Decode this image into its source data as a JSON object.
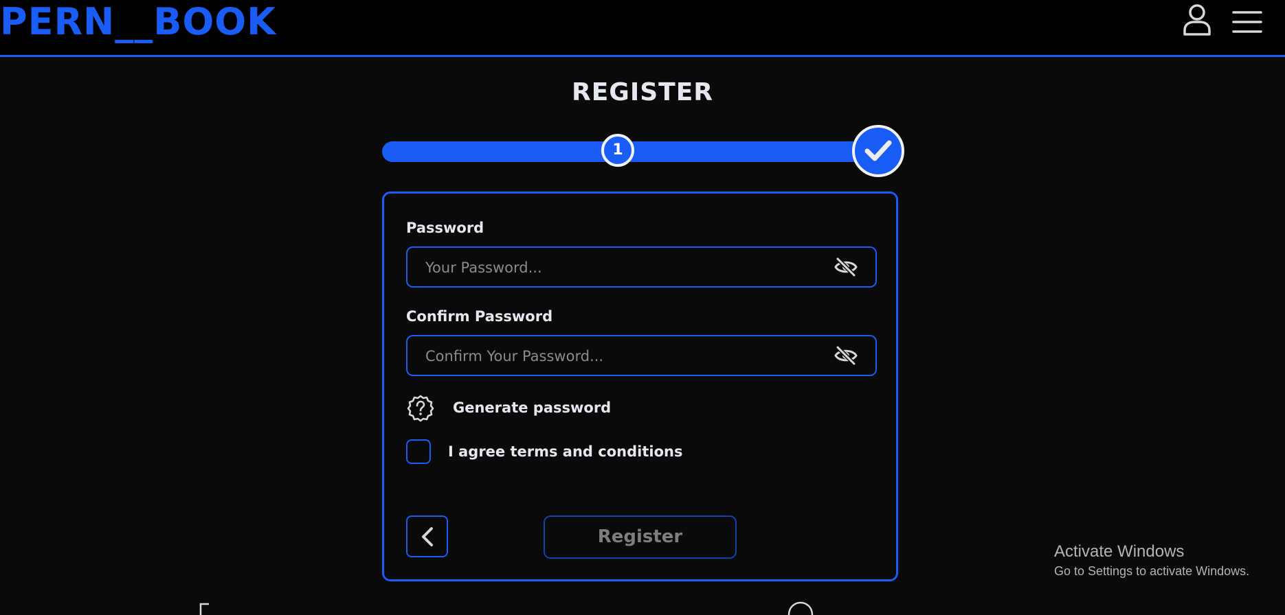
{
  "header": {
    "logo": "PERN__BOOK",
    "user_icon": "user-icon",
    "menu_icon": "hamburger-menu-icon"
  },
  "page": {
    "title": "REGISTER"
  },
  "stepper": {
    "step_label": "1",
    "done_icon": "check-icon"
  },
  "form": {
    "password_label": "Password",
    "password_placeholder": "Your Password...",
    "confirm_label": "Confirm Password",
    "confirm_placeholder": "Confirm Your Password...",
    "visibility_icon": "eye-off-icon",
    "generate_label": "Generate password",
    "generate_icon": "question-badge-icon",
    "agree_label": "I agree terms and conditions",
    "agree_checked": false,
    "back_icon": "chevron-left-icon",
    "register_label": "Register"
  },
  "watermark": {
    "title": "Activate Windows",
    "subtitle": "Go to Settings to activate Windows."
  },
  "colors": {
    "accent": "#1a5cf6",
    "background": "#0a0a0b",
    "text": "#e6e8f0"
  }
}
